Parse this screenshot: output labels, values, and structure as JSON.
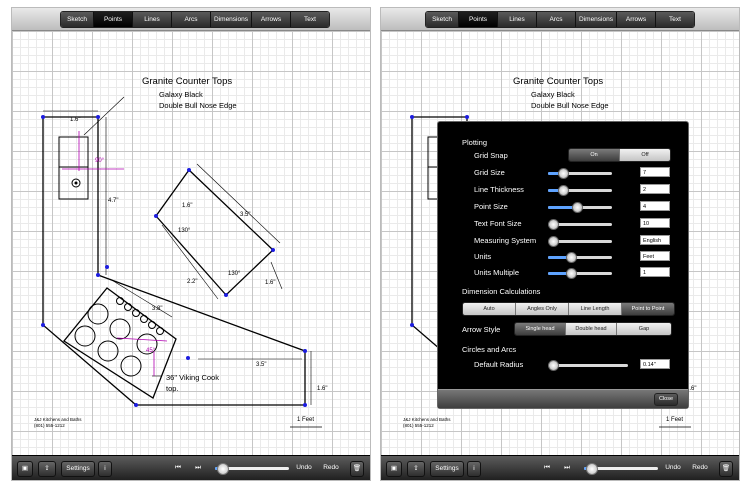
{
  "toolbar_tabs": [
    {
      "label": "Sketch",
      "selected": false
    },
    {
      "label": "Points",
      "selected": true
    },
    {
      "label": "Lines",
      "selected": false
    },
    {
      "label": "Arcs",
      "selected": false
    },
    {
      "label": "Dimensions",
      "selected": false
    },
    {
      "label": "Arrows",
      "selected": false
    },
    {
      "label": "Text",
      "selected": false
    }
  ],
  "drawing": {
    "title": "Granite Counter Tops",
    "line1": "Galaxy Black",
    "line2": "Double Bull Nose Edge",
    "note1": "36\" Viking Cook",
    "note2": "top.",
    "company_name": "J&J Kitchens and Baths",
    "company_phone": "(801) 555-1212",
    "scale_label": "1 Feet",
    "dims": {
      "d16": "1.6\"",
      "d47": "4.7\"",
      "d90": "90°",
      "d35a": "3.5\"",
      "d16b": "1.6\"",
      "d130a": "130°",
      "d22": "2.2\"",
      "d130b": "130°",
      "d16c": "1.6\"",
      "d38": "3.8\"",
      "d45": "45°",
      "d35b": "3.5\"",
      "d16d": "1.6\""
    }
  },
  "bottombar": {
    "settings_label": "Settings",
    "info_label": "i",
    "undo_label": "Undo",
    "redo_label": "Redo",
    "trash_icon": "trash-icon",
    "zoom_fraction": 0.1
  },
  "dialog": {
    "plotting_label": "Plotting",
    "grid_snap_label": "Grid Snap",
    "grid_snap_options": [
      "On",
      "Off"
    ],
    "grid_snap_selected": "On",
    "grid_size_label": "Grid Size",
    "grid_size_value": "7",
    "line_thickness_label": "Line Thickness",
    "line_thickness_value": "2",
    "point_size_label": "Point Size",
    "point_size_value": "4",
    "text_font_size_label": "Text Font Size",
    "text_font_size_value": "10",
    "measuring_system_label": "Measuring System",
    "measuring_system_value": "English",
    "units_label": "Units",
    "units_value": "Feet",
    "units_multiple_label": "Units Multiple",
    "units_multiple_value": "1",
    "dimension_calc_label": "Dimension Calculations",
    "dimension_calc_options": [
      "Auto",
      "Angles Only",
      "Line Length",
      "Point to Point"
    ],
    "dimension_calc_selected": "Point to Point",
    "arrow_style_label": "Arrow Style",
    "arrow_style_options": [
      "Single head",
      "Double head",
      "Gap"
    ],
    "arrow_style_selected": "Single head",
    "circles_arcs_label": "Circles and Arcs",
    "default_radius_label": "Default Radius",
    "default_radius_value": "0.14\"",
    "close_label": "Close"
  },
  "colors": {
    "accent": "#5ea3ff",
    "point_blue": "#1d1de0",
    "dimension_magenta": "#b000b0"
  }
}
